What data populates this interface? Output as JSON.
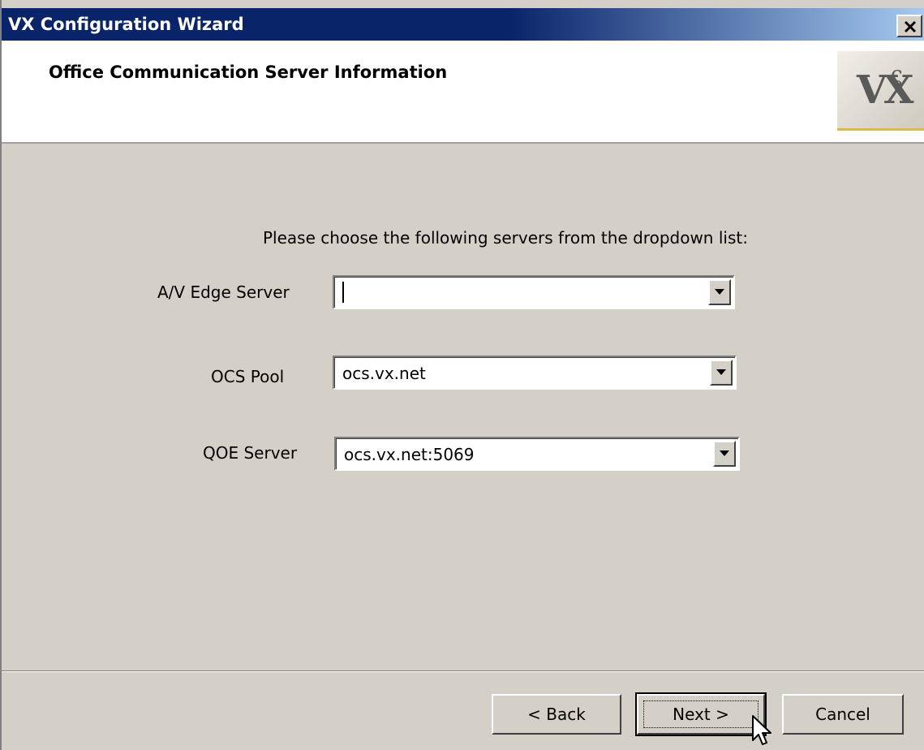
{
  "window": {
    "title": "VX Configuration Wizard",
    "close_glyph": "✕"
  },
  "header": {
    "heading": "Office Communication Server Information",
    "logo_text": "VX"
  },
  "main": {
    "prompt": "Please choose the following servers from the dropdown list:",
    "fields": [
      {
        "label": "A/V Edge Server",
        "value": ""
      },
      {
        "label": "OCS Pool",
        "value": "ocs.vx.net"
      },
      {
        "label": "QOE Server",
        "value": "ocs.vx.net:5069"
      }
    ]
  },
  "footer": {
    "back_label": "< Back",
    "next_label": "Next >",
    "cancel_label": "Cancel"
  },
  "colors": {
    "titlebar": "#0a246a",
    "dialog_face": "#d4d0c8",
    "logo_underline": "#e0b848"
  }
}
